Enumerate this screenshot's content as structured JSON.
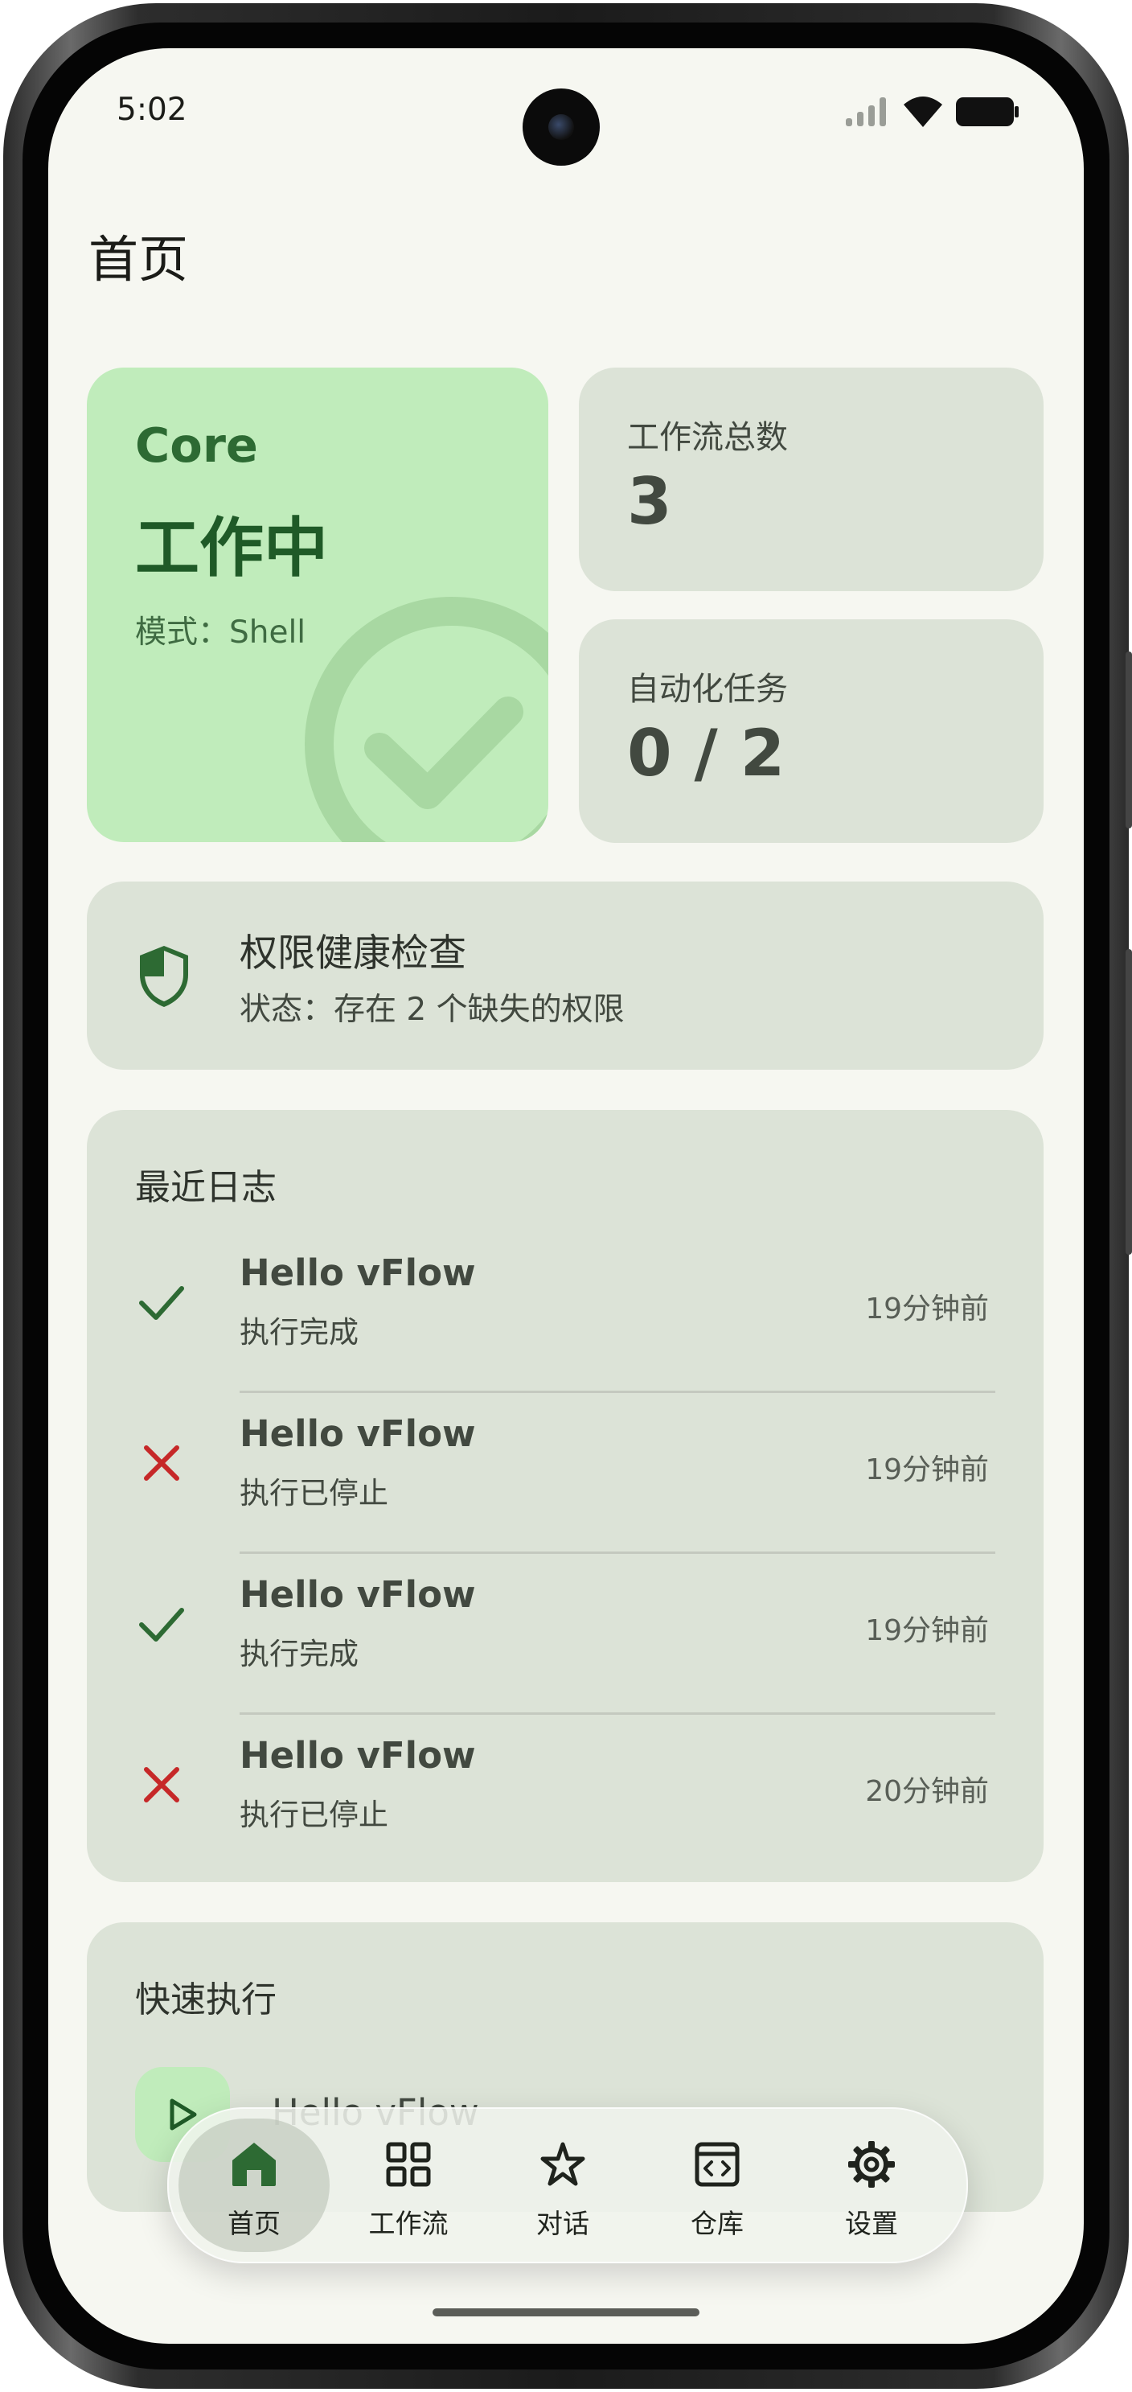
{
  "status_bar": {
    "time": "5:02"
  },
  "page": {
    "title": "首页"
  },
  "core_card": {
    "label": "Core",
    "state": "工作中",
    "mode": "模式：Shell"
  },
  "stats": {
    "workflows_label": "工作流总数",
    "workflows_value": "3",
    "automation_label": "自动化任务",
    "automation_value": "0 / 2"
  },
  "permissions": {
    "title": "权限健康检查",
    "status": "状态：存在 2 个缺失的权限"
  },
  "recent_logs": {
    "title": "最近日志",
    "items": [
      {
        "name": "Hello vFlow",
        "status": "执行完成",
        "time": "19分钟前",
        "result": "success"
      },
      {
        "name": "Hello vFlow",
        "status": "执行已停止",
        "time": "19分钟前",
        "result": "stopped"
      },
      {
        "name": "Hello vFlow",
        "status": "执行完成",
        "time": "19分钟前",
        "result": "success"
      },
      {
        "name": "Hello vFlow",
        "status": "执行已停止",
        "time": "20分钟前",
        "result": "stopped"
      }
    ]
  },
  "quick_run": {
    "title": "快速执行",
    "items": [
      {
        "name": "Hello vFlow"
      }
    ]
  },
  "nav": {
    "items": [
      {
        "label": "首页",
        "icon": "home-icon",
        "active": true
      },
      {
        "label": "工作流",
        "icon": "grid-icon",
        "active": false
      },
      {
        "label": "对话",
        "icon": "sparkle-icon",
        "active": false
      },
      {
        "label": "仓库",
        "icon": "code-box-icon",
        "active": false
      },
      {
        "label": "设置",
        "icon": "gear-icon",
        "active": false
      }
    ]
  },
  "colors": {
    "background": "#f6f7f1",
    "card": "#dce3d7",
    "core_card": "#c0ecbb",
    "accent_green": "#2d6a33",
    "error_red": "#c62828"
  }
}
